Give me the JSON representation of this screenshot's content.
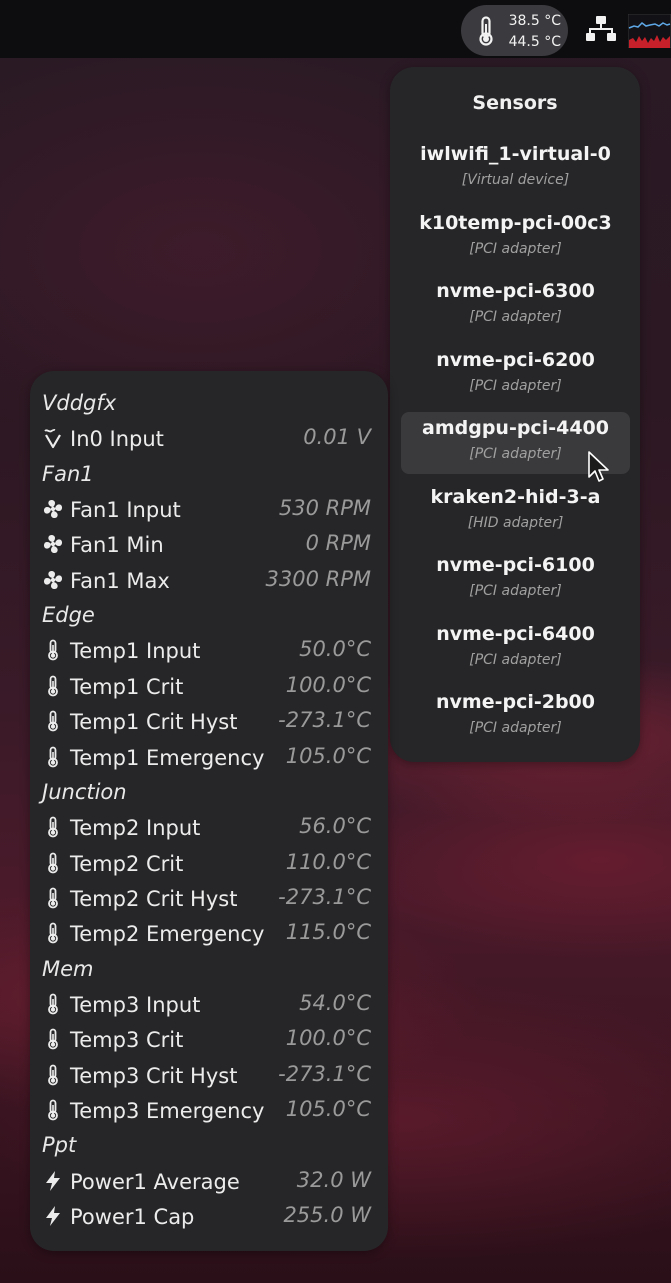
{
  "topbar": {
    "temp_icon": "thermometer-icon",
    "temp_values": [
      "38.5 °C",
      "44.5 °C"
    ],
    "network_icon": "network-icon",
    "system_monitor_icon": "system-monitor-graph-icon"
  },
  "sensors": {
    "title": "Sensors",
    "devices": [
      {
        "name": "iwlwifi_1-virtual-0",
        "type": "[Virtual device]"
      },
      {
        "name": "k10temp-pci-00c3",
        "type": "[PCI adapter]"
      },
      {
        "name": "nvme-pci-6300",
        "type": "[PCI adapter]"
      },
      {
        "name": "nvme-pci-6200",
        "type": "[PCI adapter]"
      },
      {
        "name": "amdgpu-pci-4400",
        "type": "[PCI adapter]",
        "selected": true
      },
      {
        "name": "kraken2-hid-3-a",
        "type": "[HID adapter]"
      },
      {
        "name": "nvme-pci-6100",
        "type": "[PCI adapter]"
      },
      {
        "name": "nvme-pci-6400",
        "type": "[PCI adapter]"
      },
      {
        "name": "nvme-pci-2b00",
        "type": "[PCI adapter]"
      }
    ]
  },
  "readings": [
    {
      "group": "Vddgfx"
    },
    {
      "icon": "voltage-icon",
      "label": "In0 Input",
      "value": "0.01 V"
    },
    {
      "group": "Fan1"
    },
    {
      "icon": "fan-icon",
      "label": "Fan1 Input",
      "value": "530 RPM"
    },
    {
      "icon": "fan-icon",
      "label": "Fan1 Min",
      "value": "0 RPM"
    },
    {
      "icon": "fan-icon",
      "label": "Fan1 Max",
      "value": "3300 RPM"
    },
    {
      "group": "Edge"
    },
    {
      "icon": "thermometer-icon",
      "label": "Temp1 Input",
      "value": "50.0°C"
    },
    {
      "icon": "thermometer-icon",
      "label": "Temp1 Crit",
      "value": "100.0°C"
    },
    {
      "icon": "thermometer-icon",
      "label": "Temp1 Crit Hyst",
      "value": "-273.1°C"
    },
    {
      "icon": "thermometer-icon",
      "label": "Temp1 Emergency",
      "value": "105.0°C"
    },
    {
      "group": "Junction"
    },
    {
      "icon": "thermometer-icon",
      "label": "Temp2 Input",
      "value": "56.0°C"
    },
    {
      "icon": "thermometer-icon",
      "label": "Temp2 Crit",
      "value": "110.0°C"
    },
    {
      "icon": "thermometer-icon",
      "label": "Temp2 Crit Hyst",
      "value": "-273.1°C"
    },
    {
      "icon": "thermometer-icon",
      "label": "Temp2 Emergency",
      "value": "115.0°C"
    },
    {
      "group": "Mem"
    },
    {
      "icon": "thermometer-icon",
      "label": "Temp3 Input",
      "value": "54.0°C"
    },
    {
      "icon": "thermometer-icon",
      "label": "Temp3 Crit",
      "value": "100.0°C"
    },
    {
      "icon": "thermometer-icon",
      "label": "Temp3 Crit Hyst",
      "value": "-273.1°C"
    },
    {
      "icon": "thermometer-icon",
      "label": "Temp3 Emergency",
      "value": "105.0°C"
    },
    {
      "group": "Ppt"
    },
    {
      "icon": "power-icon",
      "label": "Power1 Average",
      "value": "32.0 W"
    },
    {
      "icon": "power-icon",
      "label": "Power1 Cap",
      "value": "255.0 W"
    }
  ]
}
